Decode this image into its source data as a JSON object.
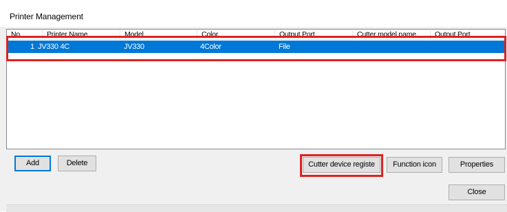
{
  "window": {
    "title": "Printer Management"
  },
  "list": {
    "columns": [
      {
        "label": "No."
      },
      {
        "label": "Printer Name"
      },
      {
        "label": "Model"
      },
      {
        "label": "Color"
      },
      {
        "label": "Output Port"
      },
      {
        "label": "Cutter model name"
      },
      {
        "label": "Output Port"
      }
    ],
    "rows": [
      {
        "no": "1",
        "printer_name": "JV330 4C",
        "model": "JV330",
        "color": "4Color",
        "output_port": "File",
        "cutter_model_name": "",
        "cutter_output_port": "",
        "selected": true
      }
    ]
  },
  "buttons": {
    "add": "Add",
    "delete": "Delete",
    "cutter_device_register": "Cutter device registe",
    "function_icon": "Function icon",
    "properties": "Properties",
    "close": "Close"
  },
  "colors": {
    "selection": "#0078d7",
    "highlight_annotation": "#e02020",
    "button_face": "#e1e1e1"
  }
}
